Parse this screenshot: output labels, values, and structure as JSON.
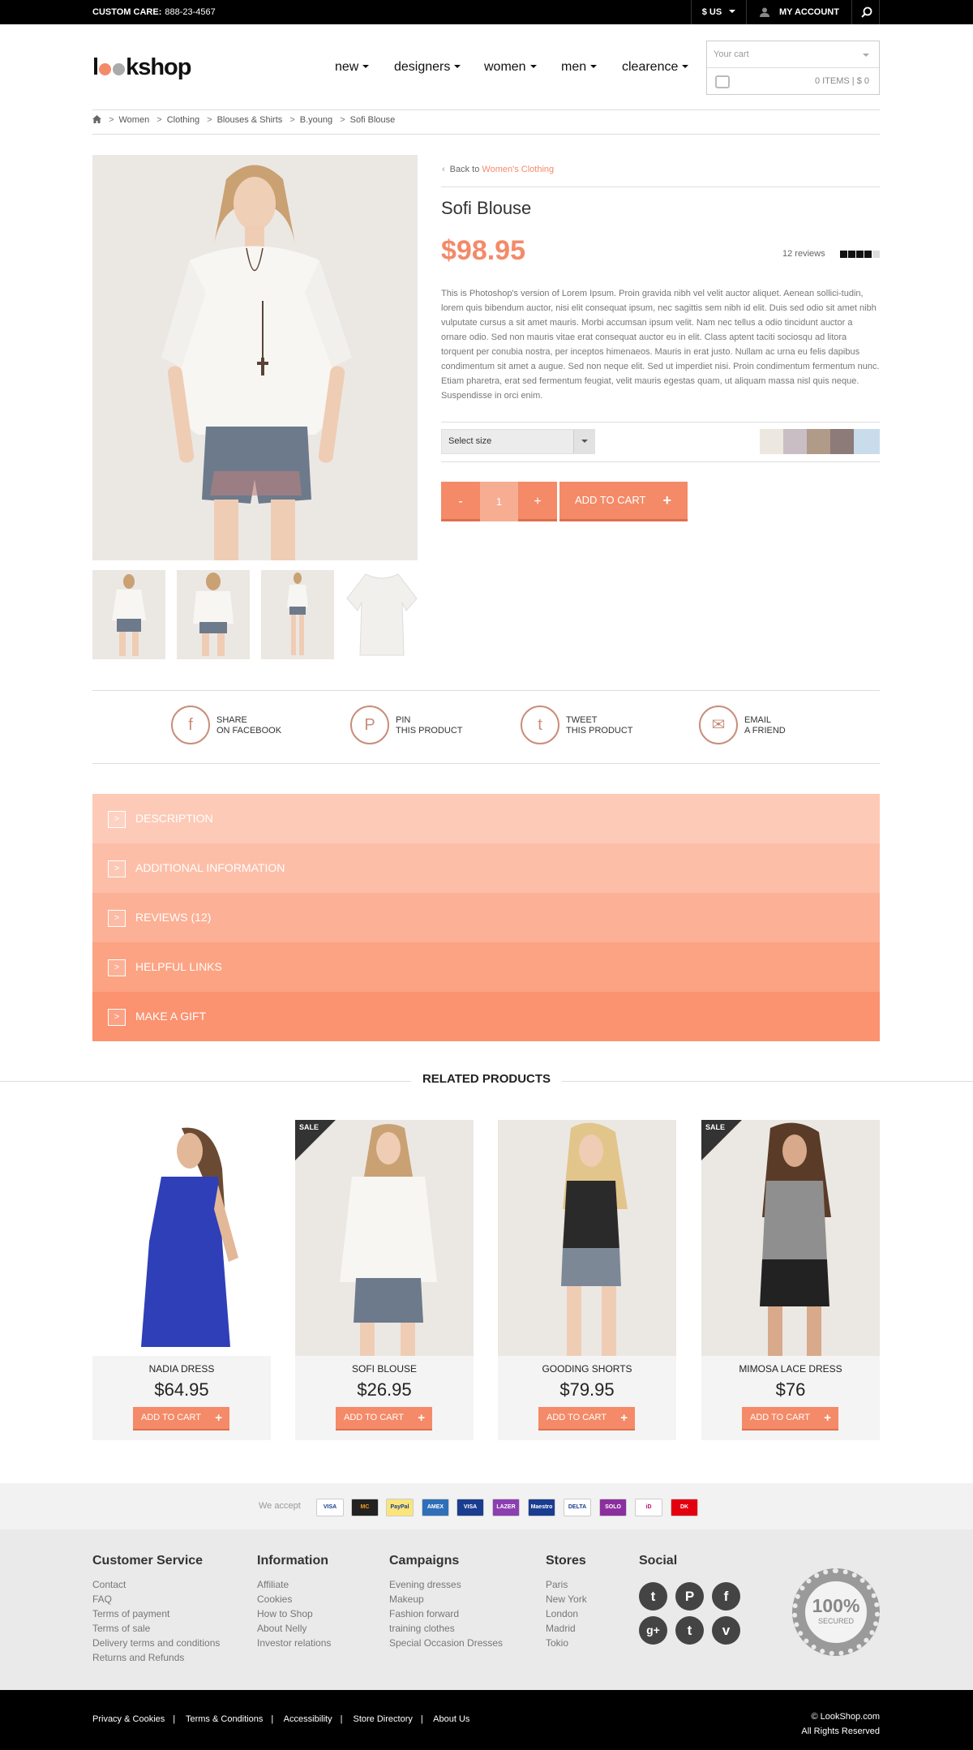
{
  "topbar": {
    "care_label": "CUSTOM CARE:",
    "care_phone": "888-23-4567",
    "currency": "$ US",
    "account": "MY ACCOUNT"
  },
  "header": {
    "logo_pre": "l",
    "logo_post": "kshop",
    "nav": [
      "new",
      "designers",
      "women",
      "men",
      "clearence"
    ],
    "cart_label": "Your cart",
    "cart_summary": "0 ITEMS  |  $ 0"
  },
  "breadcrumb": [
    "Women",
    "Clothing",
    "Blouses & Shirts",
    "B.young",
    "Sofi Blouse"
  ],
  "product": {
    "back_text": "Back to",
    "back_link": "Women's Clothing",
    "title": "Sofi Blouse",
    "price": "$98.95",
    "reviews": "12 reviews",
    "rating": 4,
    "description": "This is Photoshop's version  of Lorem Ipsum. Proin gravida nibh vel velit auctor aliquet. Aenean sollici-tudin, lorem quis bibendum auctor, nisi elit consequat ipsum, nec sagittis sem nibh id elit. Duis sed odio sit amet nibh vulputate cursus a sit amet mauris. Morbi accumsan ipsum velit. Nam nec tellus a odio tincidunt auctor a ornare odio. Sed non  mauris vitae erat consequat auctor eu in elit. Class aptent taciti sociosqu ad litora torquent per conubia nostra, per inceptos himenaeos. Mauris in erat justo. Nullam ac urna eu felis dapibus condimentum sit amet a augue. Sed non neque elit. Sed ut imperdiet nisi. Proin condimentum fermentum nunc. Etiam pharetra, erat sed fermentum feugiat, velit mauris egestas quam, ut aliquam massa nisl quis neque. Suspendisse in orci enim.",
    "size_select": "Select size",
    "swatches": [
      "#ece8df",
      "#c8bec4",
      "#b09a88",
      "#8c7b78",
      "#c9dcec"
    ],
    "qty_minus": "-",
    "qty": "1",
    "qty_plus": "+",
    "add_to_cart": "ADD TO CART",
    "add_plus": "+"
  },
  "share": [
    {
      "icon": "facebook-icon",
      "glyph": "f",
      "line1": "SHARE",
      "line2": "ON FACEBOOK"
    },
    {
      "icon": "pinterest-icon",
      "glyph": "P",
      "line1": "PIN",
      "line2": "THIS PRODUCT"
    },
    {
      "icon": "twitter-icon",
      "glyph": "t",
      "line1": "TWEET",
      "line2": "THIS PRODUCT"
    },
    {
      "icon": "email-icon",
      "glyph": "✉",
      "line1": "EMAIL",
      "line2": "A FRIEND"
    }
  ],
  "accordion": {
    "arrow": ">",
    "items": [
      "DESCRIPTION",
      "ADDITIONAL INFORMATION",
      "REVIEWS (12)",
      "HELPFUL LINKS",
      "MAKE A GIFT"
    ],
    "colors": [
      "#fdcab8",
      "#fdbea8",
      "#fcb095",
      "#fca383",
      "#fb9270"
    ]
  },
  "related": {
    "title": "RELATED PRODUCTS",
    "sale_label": "SALE",
    "add_label": "ADD TO CART",
    "add_plus": "+",
    "items": [
      {
        "name": "NADIA DRESS",
        "price": "$64.95"
      },
      {
        "name": "SOFI BLOUSE",
        "price": "$26.95"
      },
      {
        "name": "GOODING SHORTS",
        "price": "$79.95"
      },
      {
        "name": "MIMOSA LACE DRESS",
        "price": "$76"
      }
    ]
  },
  "payments": {
    "label": "We accept",
    "cards": [
      "VISA",
      "MC",
      "PayPal",
      "AMEX",
      "VISA",
      "LAZER",
      "Maestro",
      "DELTA",
      "SOLO",
      "iD",
      "DK"
    ]
  },
  "footer": {
    "columns": [
      {
        "title": "Customer Service",
        "links": [
          "Contact",
          "FAQ",
          "Terms of payment",
          "Terms of sale",
          "Delivery terms and conditions",
          "Returns and Refunds"
        ]
      },
      {
        "title": "Information",
        "links": [
          "Affiliate",
          "Cookies",
          "How to Shop",
          "About Nelly",
          "Investor relations"
        ]
      },
      {
        "title": "Campaigns",
        "links": [
          "Evening dresses",
          "Makeup",
          "Fashion forward",
          "training clothes",
          "Special Occasion Dresses"
        ]
      },
      {
        "title": "Stores",
        "links": [
          "Paris",
          "New York",
          "London",
          "Madrid",
          "Tokio"
        ]
      }
    ],
    "social_title": "Social",
    "social": [
      "t",
      "P",
      "f",
      "g+",
      "t",
      "v"
    ],
    "seal_big": "100%",
    "seal_small": "SECURED",
    "bottom_links": [
      "Privacy & Cookies",
      "Terms & Conditions",
      "Accessibility",
      "Store Directory",
      "About Us"
    ],
    "copyright": "© LookShop.com",
    "rights": "All Rights Reserved"
  }
}
